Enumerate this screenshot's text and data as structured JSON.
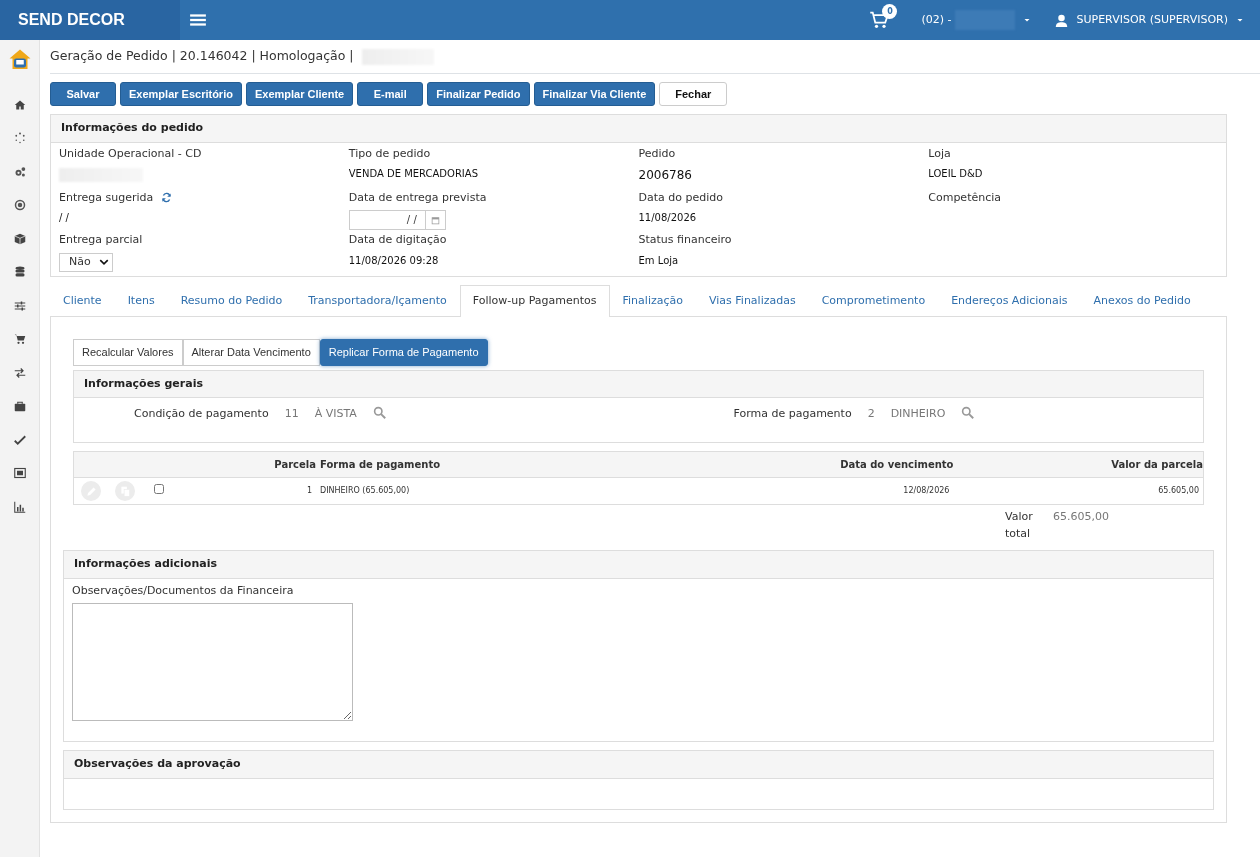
{
  "topbar": {
    "brand": "SEND DECOR",
    "cart_count": "0",
    "unit": "(02) -",
    "unit_redacted": true,
    "user": "SUPERVISOR (SUPERVISOR)"
  },
  "sidebar": {
    "items": [
      {
        "kind": "home"
      },
      {
        "kind": "spinner"
      },
      {
        "kind": "cogs"
      },
      {
        "kind": "target"
      },
      {
        "kind": "cube"
      },
      {
        "kind": "database"
      },
      {
        "kind": "sliders"
      },
      {
        "kind": "cart"
      },
      {
        "kind": "exchange"
      },
      {
        "kind": "bag"
      },
      {
        "kind": "check"
      },
      {
        "kind": "frame"
      },
      {
        "kind": "chart"
      }
    ]
  },
  "page_title": {
    "text": "Geração de Pedido | 20.146042 | Homologação |",
    "redacted": true
  },
  "actions": [
    {
      "label": "Salvar",
      "kind": "primary"
    },
    {
      "label": "Exemplar Escritório",
      "kind": "primary"
    },
    {
      "label": "Exemplar Cliente",
      "kind": "primary"
    },
    {
      "label": "E-mail",
      "kind": "primary"
    },
    {
      "label": "Finalizar Pedido",
      "kind": "primary"
    },
    {
      "label": "Finalizar Via Cliente",
      "kind": "primary"
    },
    {
      "label": "Fechar",
      "kind": "light"
    }
  ],
  "order_info": {
    "title": "Informações do pedido",
    "fields": [
      {
        "label": "Unidade Operacional - CD",
        "kind": "redacted"
      },
      {
        "label": "Tipo de pedido",
        "kind": "text",
        "value": "VENDA DE MERCADORIAS"
      },
      {
        "label": "Pedido",
        "kind": "big",
        "value": "2006786"
      },
      {
        "label": "Loja",
        "kind": "text",
        "value": "LOEIL D&D"
      },
      {
        "label": "Entrega sugerida",
        "kind": "refresh",
        "value": "/ /"
      },
      {
        "label": "Data de entrega prevista",
        "kind": "date",
        "value": "/ /"
      },
      {
        "label": "Data do pedido",
        "kind": "text",
        "value": "11/08/2026"
      },
      {
        "label": "Competência",
        "kind": "empty"
      },
      {
        "label": "Entrega parcial",
        "kind": "select",
        "value": "Não"
      },
      {
        "label": "Data de digitação",
        "kind": "text",
        "value": "11/08/2026 09:28"
      },
      {
        "label": "Status financeiro",
        "kind": "text",
        "value": "Em Loja"
      }
    ]
  },
  "tabs": [
    {
      "label": "Cliente",
      "selected": false
    },
    {
      "label": "Itens",
      "selected": false
    },
    {
      "label": "Resumo do Pedido",
      "selected": false
    },
    {
      "label": "Transportadora/Içamento",
      "selected": false
    },
    {
      "label": "Follow-up Pagamentos",
      "selected": true
    },
    {
      "label": "Finalização",
      "selected": false
    },
    {
      "label": "Vias Finalizadas",
      "selected": false
    },
    {
      "label": "Comprometimento",
      "selected": false
    },
    {
      "label": "Endereços Adicionais",
      "selected": false
    },
    {
      "label": "Anexos do Pedido",
      "selected": false
    }
  ],
  "subtabs": [
    {
      "label": "Recalcular Valores",
      "selected": false
    },
    {
      "label": "Alterar Data Vencimento",
      "selected": false
    },
    {
      "label": "Replicar Forma de Pagamento",
      "selected": true
    }
  ],
  "general_info": {
    "title": "Informações gerais",
    "fields": [
      {
        "label": "Condição de pagamento",
        "code": "11",
        "description": "À VISTA"
      },
      {
        "label": "Forma de pagamento",
        "code": "2",
        "description": "DINHEIRO"
      }
    ]
  },
  "installments": {
    "columns": [
      "Parcela",
      "Forma de pagamento",
      "Data do vencimento",
      "Valor da parcela"
    ],
    "rows": [
      {
        "checked": false,
        "cells": [
          "1",
          "DINHEIRO (65.605,00)",
          "12/08/2026",
          "65.605,00"
        ]
      }
    ],
    "total_label": "Valor total",
    "total": "65.605,00"
  },
  "additional_info": {
    "title": "Informações adicionais",
    "notes_label": "Observações/Documentos da Financeira"
  },
  "approval_notes": {
    "title": "Observações da aprovação"
  }
}
